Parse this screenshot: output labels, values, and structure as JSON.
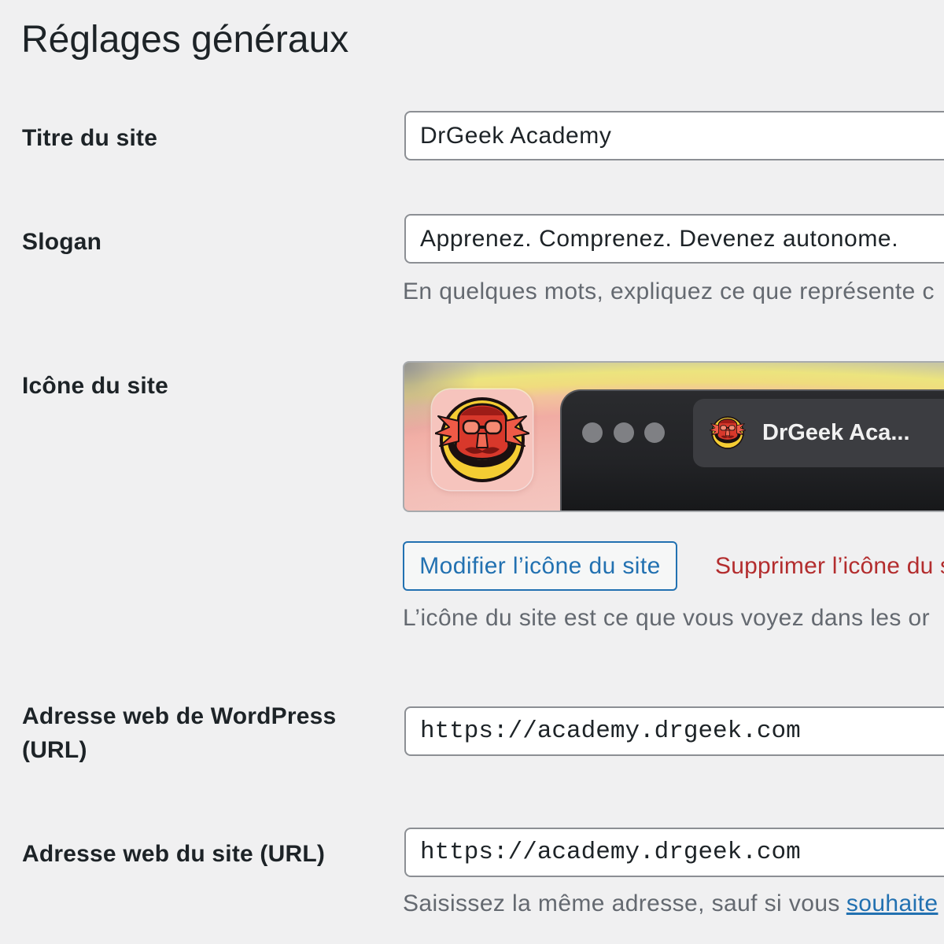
{
  "page": {
    "title": "Réglages généraux"
  },
  "settings": {
    "site_title": {
      "label": "Titre du site",
      "value": "DrGeek Academy"
    },
    "tagline": {
      "label": "Slogan",
      "value": "Apprenez. Comprenez. Devenez autonome.",
      "description": "En quelques mots, expliquez ce que représente c"
    },
    "site_icon": {
      "label": "Icône du site",
      "preview": {
        "tab_title": "DrGeek Aca..."
      },
      "change_button": "Modifier l’icône du site",
      "remove_button": "Supprimer l’icône du s",
      "description": "L’icône du site est ce que vous voyez dans les or"
    },
    "wordpress_address": {
      "label": "Adresse web de WordPress (URL)",
      "value": "https://academy.drgeek.com"
    },
    "site_address": {
      "label": "Adresse web du site (URL)",
      "value": "https://academy.drgeek.com",
      "description": "Saisissez la même adresse, sauf si vous",
      "description_link": "souhaite"
    }
  },
  "icons": {
    "app_icon": "drgeek-mascot-icon",
    "favicon": "drgeek-mascot-icon"
  },
  "colors": {
    "background": "#f0f0f1",
    "text": "#1d2327",
    "description": "#646970",
    "primary": "#2271b1",
    "danger": "#b32d2e",
    "input_border": "#8c8f94"
  }
}
